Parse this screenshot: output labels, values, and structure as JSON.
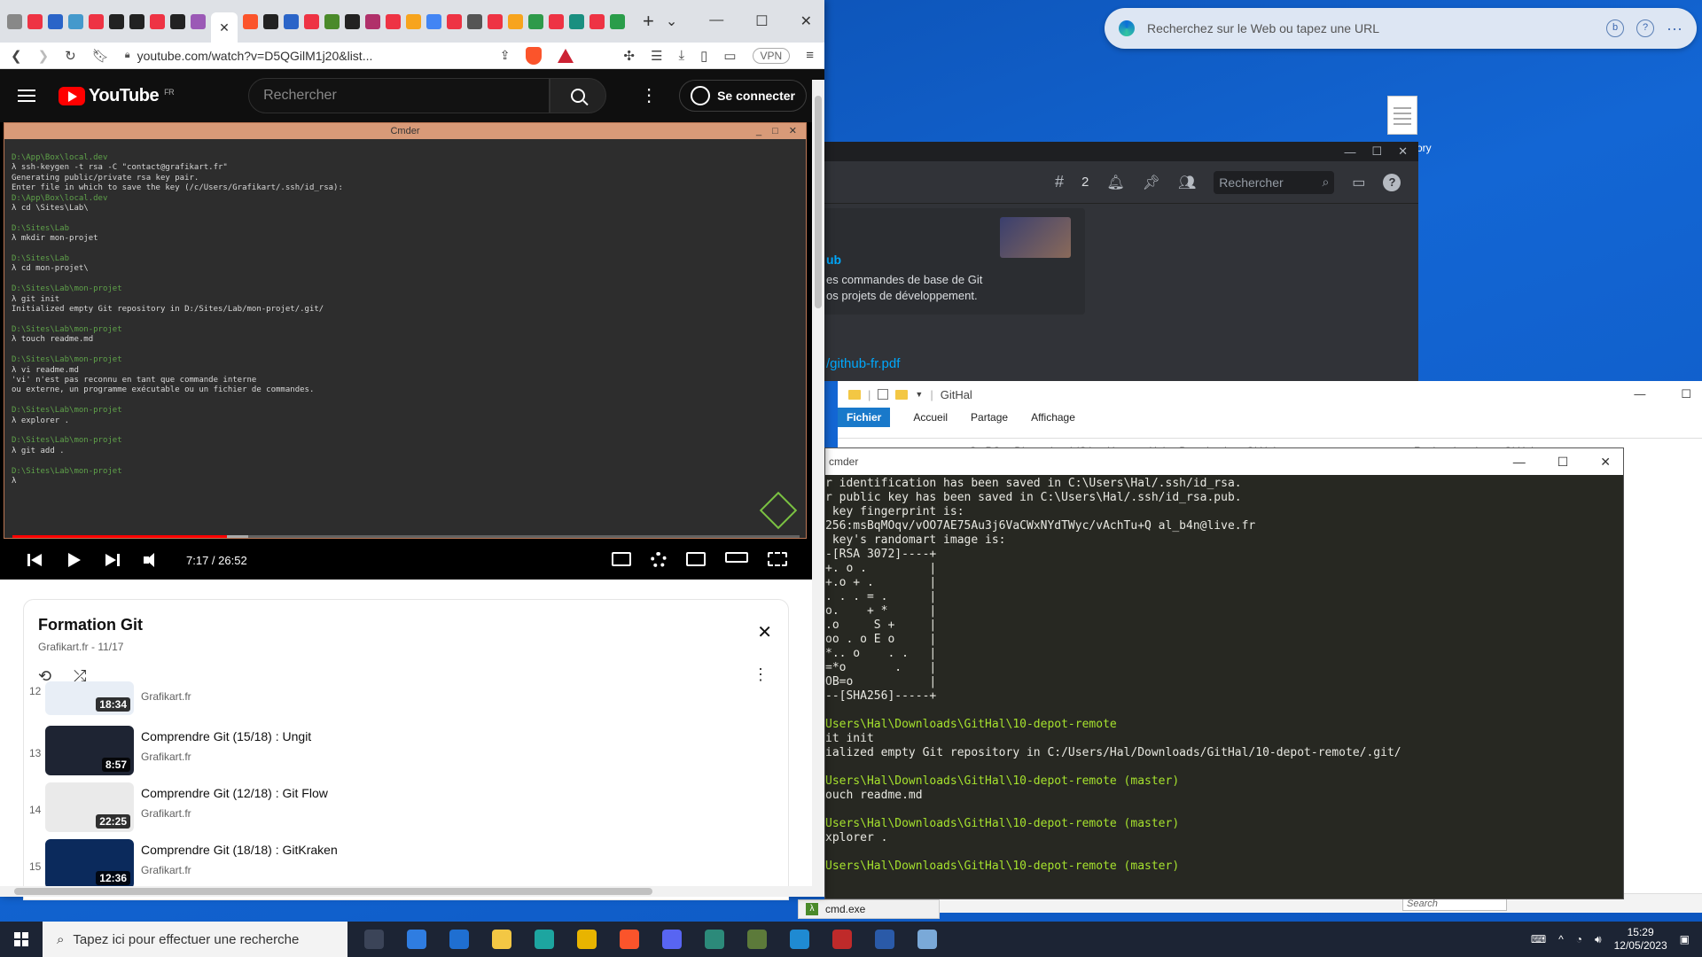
{
  "desktop": {
    "edge_search_placeholder": "Recherchez sur le Web ou tapez une URL",
    "file_label": "ory"
  },
  "discord": {
    "notifications_count": "2",
    "search_placeholder": "Rechercher",
    "embed_title": "ub",
    "embed_line1": "es commandes de base de Git",
    "embed_line2": "os projets de développement.",
    "pdf_link": "/github-fr.pdf"
  },
  "explorer": {
    "title": "GitHal",
    "tabs": [
      "Fichier",
      "Accueil",
      "Partage",
      "Affichage"
    ],
    "breadcrumb": [
      "Ce PC",
      "Disque local (C:)",
      "Users",
      "Hal",
      "Downloads",
      "GitHal"
    ],
    "search_placeholder": "Rechercher dans : GitHal",
    "status_search_placeholder": "Search"
  },
  "cmd": {
    "title": "cmder",
    "taskbar_label": "cmd.exe",
    "lines": [
      {
        "t": "r identification has been saved in C:\\Users\\Hal/.ssh/id_rsa.",
        "c": "text"
      },
      {
        "t": "r public key has been saved in C:\\Users\\Hal/.ssh/id_rsa.pub.",
        "c": "text"
      },
      {
        "t": " key fingerprint is:",
        "c": "text"
      },
      {
        "t": "256:msBqMOqv/vOO7AE75Au3j6VaCWxNYdTWyc/vAchTu+Q al_b4n@live.fr",
        "c": "text"
      },
      {
        "t": " key's randomart image is:",
        "c": "text"
      },
      {
        "t": "-[RSA 3072]----+",
        "c": "text"
      },
      {
        "t": "+. o .         |",
        "c": "text"
      },
      {
        "t": "+.o + .        |",
        "c": "text"
      },
      {
        "t": ". . . = .      |",
        "c": "text"
      },
      {
        "t": "o.    + *      |",
        "c": "text"
      },
      {
        "t": ".o     S +     |",
        "c": "text"
      },
      {
        "t": "oo . o E o     |",
        "c": "text"
      },
      {
        "t": "*.. o    . .   |",
        "c": "text"
      },
      {
        "t": "=*o       .    |",
        "c": "text"
      },
      {
        "t": "OB=o           |",
        "c": "text"
      },
      {
        "t": "--[SHA256]-----+",
        "c": "text"
      },
      {
        "t": "",
        "c": "text"
      },
      {
        "t": "Users\\Hal\\Downloads\\GitHal\\10-depot-remote",
        "c": "path"
      },
      {
        "t": "it init",
        "c": "text"
      },
      {
        "t": "ialized empty Git repository in C:/Users/Hal/Downloads/GitHal/10-depot-remote/.git/",
        "c": "text"
      },
      {
        "t": "",
        "c": "text"
      },
      {
        "t": "Users\\Hal\\Downloads\\GitHal\\10-depot-remote (master)",
        "c": "path"
      },
      {
        "t": "ouch readme.md",
        "c": "text"
      },
      {
        "t": "",
        "c": "text"
      },
      {
        "t": "Users\\Hal\\Downloads\\GitHal\\10-depot-remote (master)",
        "c": "path"
      },
      {
        "t": "xplorer .",
        "c": "text"
      },
      {
        "t": "",
        "c": "text"
      },
      {
        "t": "Users\\Hal\\Downloads\\GitHal\\10-depot-remote (master)",
        "c": "path"
      }
    ]
  },
  "browser": {
    "url": "youtube.com/watch?v=D5QGilM1j20&list...",
    "vpn_label": "VPN"
  },
  "youtube": {
    "logo_text": "YouTube",
    "region": "FR",
    "search_placeholder": "Rechercher",
    "signin_label": "Se connecter",
    "video": {
      "cmder_title": "Cmder",
      "time": "7:17 / 26:52",
      "progress_fraction": 0.273,
      "buffered_fraction": 0.3,
      "terminal": [
        {
          "t": "D:\\App\\Box\\local.dev",
          "c": "p"
        },
        {
          "t": "λ ssh-keygen -t rsa -C \"contact@grafikart.fr\"",
          "c": "t"
        },
        {
          "t": "Generating public/private rsa key pair.",
          "c": "t"
        },
        {
          "t": "Enter file in which to save the key (/c/Users/Grafikart/.ssh/id_rsa):",
          "c": "t"
        },
        {
          "t": "D:\\App\\Box\\local.dev",
          "c": "p"
        },
        {
          "t": "λ cd \\Sites\\Lab\\",
          "c": "t"
        },
        {
          "t": "",
          "c": "t"
        },
        {
          "t": "D:\\Sites\\Lab",
          "c": "p"
        },
        {
          "t": "λ mkdir mon-projet",
          "c": "t"
        },
        {
          "t": "",
          "c": "t"
        },
        {
          "t": "D:\\Sites\\Lab",
          "c": "p"
        },
        {
          "t": "λ cd mon-projet\\",
          "c": "t"
        },
        {
          "t": "",
          "c": "t"
        },
        {
          "t": "D:\\Sites\\Lab\\mon-projet",
          "c": "p"
        },
        {
          "t": "λ git init",
          "c": "t"
        },
        {
          "t": "Initialized empty Git repository in D:/Sites/Lab/mon-projet/.git/",
          "c": "t"
        },
        {
          "t": "",
          "c": "t"
        },
        {
          "t": "D:\\Sites\\Lab\\mon-projet",
          "c": "p"
        },
        {
          "t": "λ touch readme.md",
          "c": "t"
        },
        {
          "t": "",
          "c": "t"
        },
        {
          "t": "D:\\Sites\\Lab\\mon-projet",
          "c": "p"
        },
        {
          "t": "λ vi readme.md",
          "c": "t"
        },
        {
          "t": "'vi' n'est pas reconnu en tant que commande interne",
          "c": "t"
        },
        {
          "t": "ou externe, un programme exécutable ou un fichier de commandes.",
          "c": "t"
        },
        {
          "t": "",
          "c": "t"
        },
        {
          "t": "D:\\Sites\\Lab\\mon-projet",
          "c": "p"
        },
        {
          "t": "λ explorer .",
          "c": "t"
        },
        {
          "t": "",
          "c": "t"
        },
        {
          "t": "D:\\Sites\\Lab\\mon-projet",
          "c": "p"
        },
        {
          "t": "λ git add .",
          "c": "t"
        },
        {
          "t": "",
          "c": "t"
        },
        {
          "t": "D:\\Sites\\Lab\\mon-projet",
          "c": "p"
        },
        {
          "t": "λ",
          "c": "t"
        }
      ]
    },
    "playlist": {
      "title": "Formation Git",
      "subtitle": "Grafikart.fr - 11/17",
      "items": [
        {
          "index": "12",
          "title": "",
          "channel": "Grafikart.fr",
          "duration": "18:34",
          "color": "#e8eef6"
        },
        {
          "index": "13",
          "title": "Comprendre Git (15/18) : Ungit",
          "channel": "Grafikart.fr",
          "duration": "8:57",
          "color": "#1e2433"
        },
        {
          "index": "14",
          "title": "Comprendre Git (12/18) : Git Flow",
          "channel": "Grafikart.fr",
          "duration": "22:25",
          "color": "#f2f2f2"
        },
        {
          "index": "15",
          "title": "Comprendre Git (18/18) : GitKraken",
          "channel": "Grafikart.fr",
          "duration": "12:36",
          "color": "#0b2a5c"
        }
      ]
    }
  },
  "taskbar": {
    "search_placeholder": "Tapez ici pour effectuer une recherche",
    "time": "15:29",
    "date": "12/05/2023",
    "apps": [
      {
        "name": "task-view",
        "color": "#3b4458"
      },
      {
        "name": "store",
        "color": "#2f7de1"
      },
      {
        "name": "mail",
        "color": "#1f6fd1"
      },
      {
        "name": "file-explorer",
        "color": "#f3c744"
      },
      {
        "name": "edge",
        "color": "#1da5a0"
      },
      {
        "name": "chrome",
        "color": "#e8b400"
      },
      {
        "name": "brave",
        "color": "#fb542b"
      },
      {
        "name": "discord",
        "color": "#5865f2"
      },
      {
        "name": "gitkraken",
        "color": "#2c8a7a"
      },
      {
        "name": "cmder",
        "color": "#5c7a3a"
      },
      {
        "name": "vscode",
        "color": "#1f8ad2"
      },
      {
        "name": "filezilla",
        "color": "#bf2a2a"
      },
      {
        "name": "powershell",
        "color": "#2a5aa8"
      },
      {
        "name": "notepad",
        "color": "#7aa9d8"
      }
    ]
  }
}
